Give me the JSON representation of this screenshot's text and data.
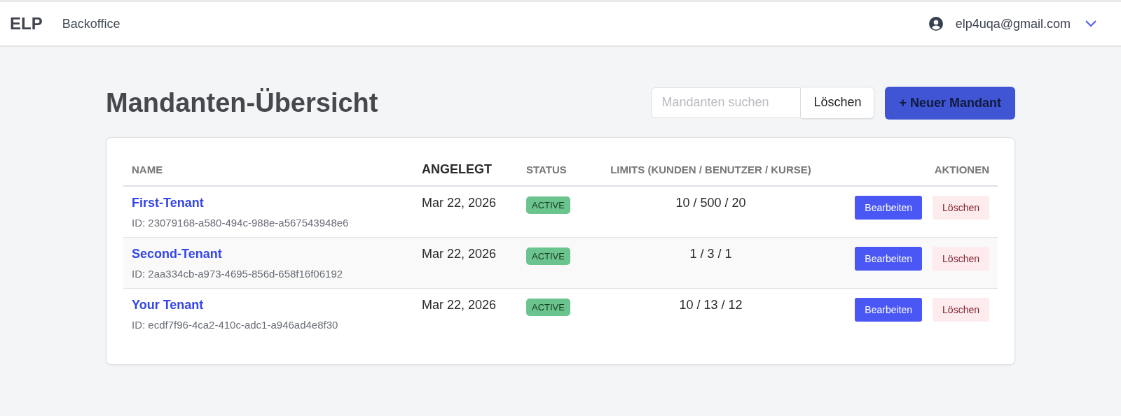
{
  "header": {
    "logo": "ELP",
    "section": "Backoffice",
    "user_email": "elp4uqa@gmail.com"
  },
  "page": {
    "title": "Mandanten-Übersicht",
    "search": {
      "placeholder": "Mandanten suchen"
    },
    "clear_button": "Löschen",
    "new_button": "+ Neuer Mandant"
  },
  "table": {
    "columns": [
      "NAME",
      "ANGELEGT",
      "STATUS",
      "LIMITS (KUNDEN / BENUTZER / KURSE)",
      "AKTIONEN"
    ],
    "rows": [
      {
        "name": "First-Tenant",
        "id": "ID: 23079168-a580-494c-988e-a567543948e6",
        "created": "Mar 22, 2026",
        "status": "ACTIVE",
        "limits": "10 / 500 / 20",
        "edit": "Bearbeiten",
        "delete": "Löschen"
      },
      {
        "name": "Second-Tenant",
        "id": "ID: 2aa334cb-a973-4695-856d-658f16f06192",
        "created": "Mar 22, 2026",
        "status": "ACTIVE",
        "limits": "1 / 3 / 1",
        "edit": "Bearbeiten",
        "delete": "Löschen"
      },
      {
        "name": "Your Tenant",
        "id": "ID: ecdf7f96-4ca2-410c-adc1-a946ad4e8f30",
        "created": "Mar 22, 2026",
        "status": "ACTIVE",
        "limits": "10 / 13 / 12",
        "edit": "Bearbeiten",
        "delete": "Löschen"
      }
    ]
  }
}
